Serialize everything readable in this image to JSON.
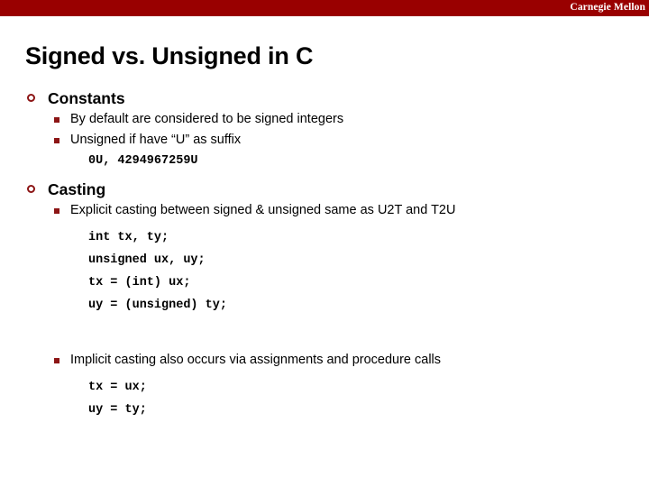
{
  "banner": {
    "brand": "Carnegie Mellon",
    "color": "#990000"
  },
  "slide": {
    "title": "Signed vs. Unsigned in C",
    "accent_color": "#8c1515",
    "text_color": "#000000",
    "background_color": "#ffffff"
  },
  "bullet_icons": {
    "level1": "hollow-circle-bullet",
    "level2": "filled-square-bullet"
  },
  "sections": [
    {
      "heading": "Constants",
      "points": [
        {
          "text": "By default are considered to be signed integers"
        },
        {
          "text": "Unsigned if have “U” as suffix"
        }
      ],
      "code": [
        "0U, 4294967259U"
      ]
    },
    {
      "heading": "Casting",
      "points": [
        {
          "text": "Explicit casting between signed & unsigned same as U2T and T2U"
        }
      ],
      "code": [
        "int tx, ty;",
        "unsigned ux, uy;",
        "tx = (int) ux;",
        "uy = (unsigned) ty;"
      ],
      "points2": [
        {
          "text": "Implicit casting also occurs via assignments and procedure calls"
        }
      ],
      "code2": [
        "tx = ux;",
        "uy = ty;"
      ]
    }
  ]
}
